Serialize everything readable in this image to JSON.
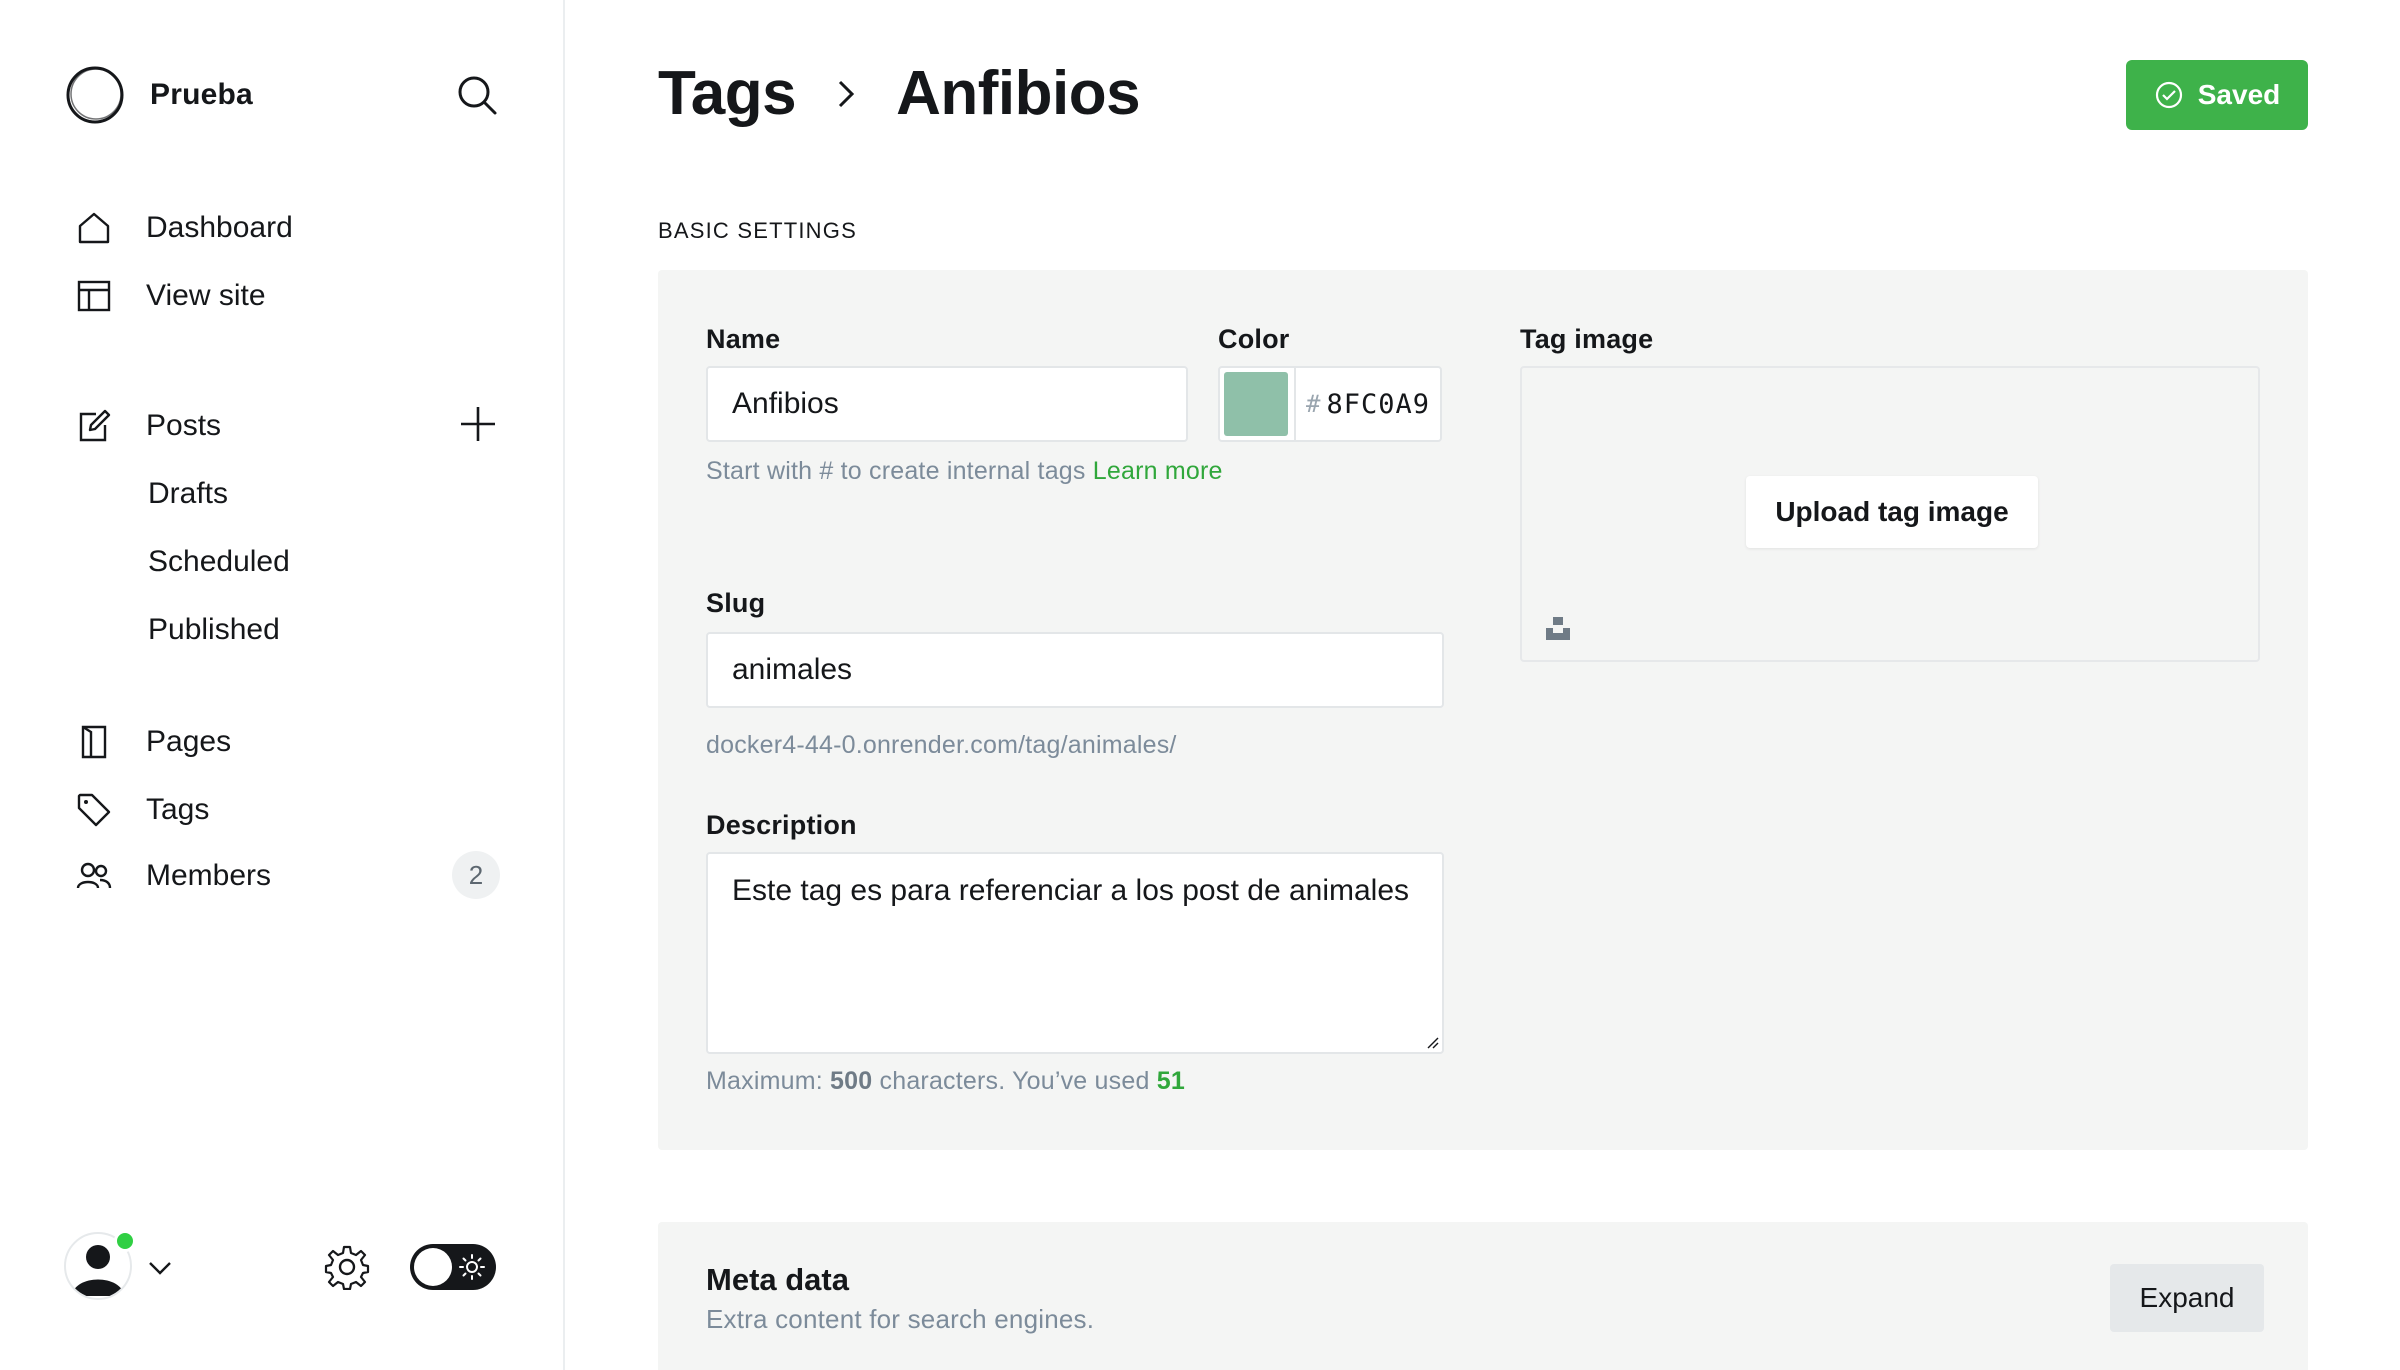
{
  "sidebar": {
    "brand_name": "Prueba",
    "nav": {
      "dashboard": "Dashboard",
      "view_site": "View site",
      "posts": "Posts",
      "drafts": "Drafts",
      "scheduled": "Scheduled",
      "published": "Published",
      "pages": "Pages",
      "tags": "Tags",
      "members": "Members",
      "members_count": "2"
    },
    "icons": [
      "search-icon",
      "home-icon",
      "layout-icon",
      "edit-icon",
      "plus-icon",
      "pages-icon",
      "tag-icon",
      "members-icon",
      "chevron-down-icon",
      "gear-icon",
      "sun-icon"
    ]
  },
  "header": {
    "breadcrumb_parent": "Tags",
    "breadcrumb_current": "Anfibios",
    "saved_label": "Saved"
  },
  "basic_settings": {
    "section_label": "BASIC SETTINGS",
    "name_label": "Name",
    "name_value": "Anfibios",
    "name_hint": "Start with # to create internal tags",
    "name_hint_link_1": "Learn",
    "name_hint_link_2": "more",
    "color_label": "Color",
    "color_hash": "#",
    "color_value": "8FC0A9",
    "color_swatch": "#8FC0A9",
    "slug_label": "Slug",
    "slug_value": "animales",
    "slug_url": "docker4-44-0.onrender.com/tag/animales/",
    "description_label": "Description",
    "description_value": "Este tag es para referenciar a los post de animales",
    "desc_hint_prefix": "Maximum:",
    "desc_hint_max": "500",
    "desc_hint_mid": "characters. You’ve used",
    "desc_hint_used": "51",
    "tag_image_label": "Tag image",
    "upload_label": "Upload tag image"
  },
  "meta_data": {
    "title": "Meta data",
    "subtitle": "Extra content for search engines.",
    "expand_label": "Expand"
  },
  "colors": {
    "accent_green": "#3eb24a",
    "link_green": "#30a73b",
    "panel_bg": "#f4f5f4"
  }
}
